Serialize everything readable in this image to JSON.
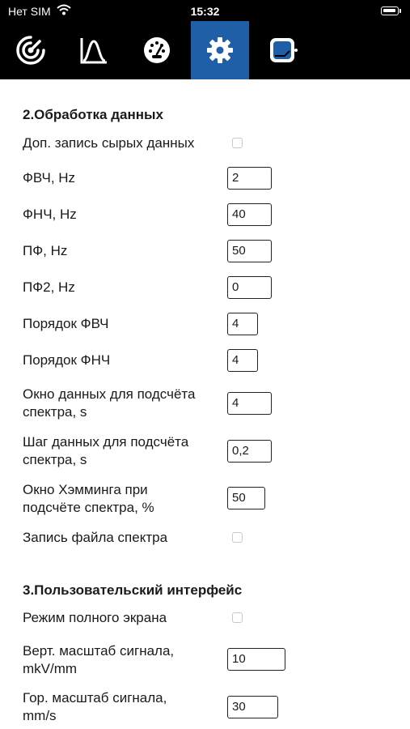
{
  "status_bar": {
    "carrier": "Нет SIM",
    "time": "15:32"
  },
  "tabs": [
    {
      "icon": "radar-icon",
      "active": false
    },
    {
      "icon": "spectrum-curve-icon",
      "active": false
    },
    {
      "icon": "gauge-icon",
      "active": false
    },
    {
      "icon": "gear-icon",
      "active": true
    },
    {
      "icon": "device-settings-icon",
      "active": false
    }
  ],
  "colors": {
    "tab_bar": "#000000",
    "active_tab": "#1f5fa8"
  },
  "section_data": {
    "title": "2.Обработка данных",
    "raw_record": {
      "label": "Доп. запись сырых данных",
      "checked": false
    },
    "hpf": {
      "label": "ФВЧ, Hz",
      "value": "2"
    },
    "lpf": {
      "label": "ФНЧ, Hz",
      "value": "40"
    },
    "notch": {
      "label": "ПФ, Hz",
      "value": "50"
    },
    "notch2": {
      "label": "ПФ2, Hz",
      "value": "0"
    },
    "hpf_order": {
      "label": "Порядок ФВЧ",
      "value": "4"
    },
    "lpf_order": {
      "label": "Порядок ФНЧ",
      "value": "4"
    },
    "spectrum_window": {
      "label_line1": "Окно данных для подсчёта",
      "label_line2": "спектра, s",
      "value": "4"
    },
    "spectrum_step": {
      "label_line1": "Шаг данных для подсчёта",
      "label_line2": "спектра, s",
      "value": "0,2"
    },
    "hamming": {
      "label_line1": "Окно Хэмминга при",
      "label_line2": "подсчёте спектра, %",
      "value": "50"
    },
    "spectrum_file": {
      "label": "Запись файла спектра",
      "checked": false
    }
  },
  "section_ui": {
    "title": "3.Пользовательский интерфейс",
    "fullscreen": {
      "label": "Режим полного экрана",
      "checked": false
    },
    "vert_scale": {
      "label_line1": "Верт. масштаб сигнала,",
      "label_line2": "mkV/mm",
      "value": "10"
    },
    "hor_scale": {
      "label_line1": "Гор. масштаб сигнала,",
      "label_line2": "mm/s",
      "value": "30"
    }
  }
}
